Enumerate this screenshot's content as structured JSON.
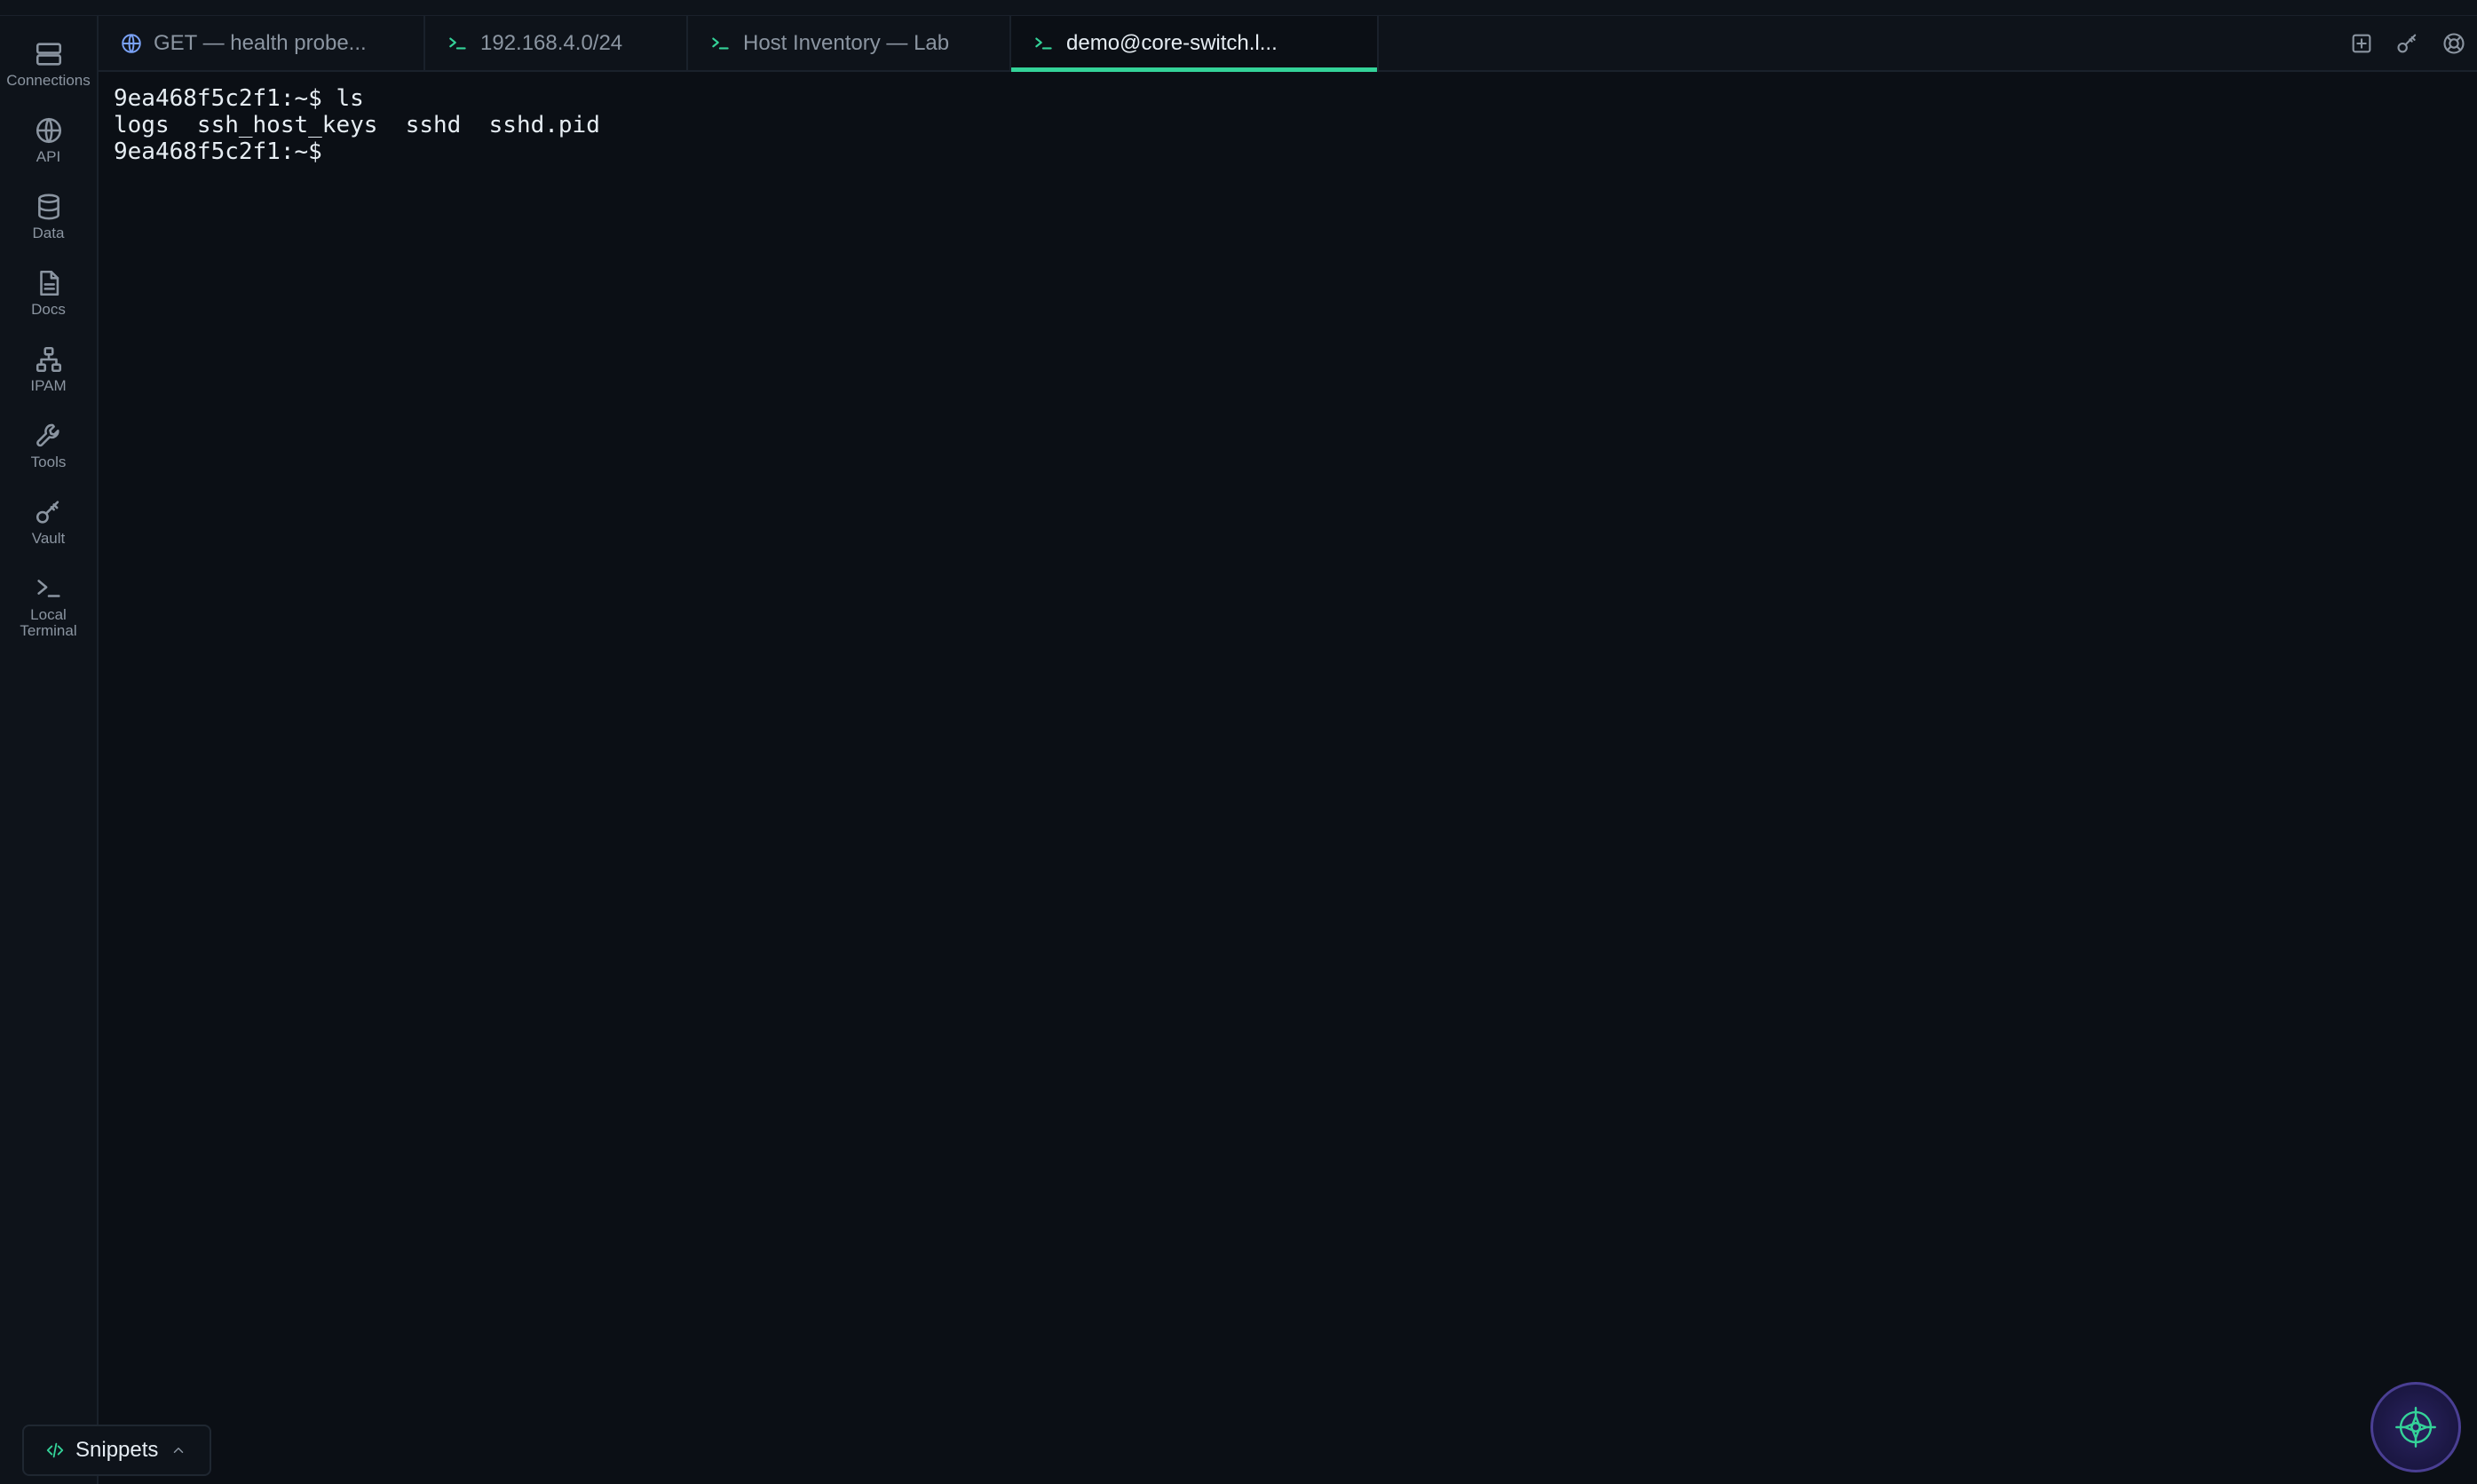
{
  "sidebar": {
    "items": [
      {
        "label": "Connections",
        "icon": "server-icon"
      },
      {
        "label": "API",
        "icon": "globe-icon"
      },
      {
        "label": "Data",
        "icon": "database-icon"
      },
      {
        "label": "Docs",
        "icon": "document-icon"
      },
      {
        "label": "IPAM",
        "icon": "network-icon"
      },
      {
        "label": "Tools",
        "icon": "wrench-icon"
      },
      {
        "label": "Vault",
        "icon": "key-icon"
      },
      {
        "label": "Local\nTerminal",
        "icon": "terminal-icon"
      }
    ]
  },
  "tabs": [
    {
      "label": "GET — health probe...",
      "icon": "globe-icon",
      "active": false
    },
    {
      "label": "192.168.4.0/24",
      "icon": "terminal-icon",
      "active": false
    },
    {
      "label": "Host Inventory — Lab",
      "icon": "terminal-icon",
      "active": false
    },
    {
      "label": "demo@core-switch.l...",
      "icon": "terminal-icon",
      "active": true
    }
  ],
  "tab_actions": [
    "new-tab-icon",
    "key-icon",
    "lifebuoy-icon"
  ],
  "terminal": {
    "lines": [
      "9ea468f5c2f1:~$ ls",
      "logs  ssh_host_keys  sshd  sshd.pid",
      "9ea468f5c2f1:~$ "
    ]
  },
  "snippets": {
    "label": "Snippets"
  },
  "colors": {
    "accent": "#34d399",
    "background": "#0b0f15",
    "panel": "#0e131a",
    "orb": "#1c1845"
  }
}
